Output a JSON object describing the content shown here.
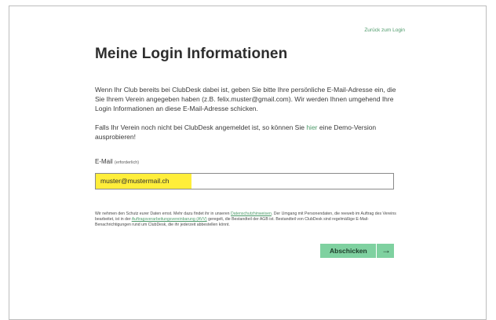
{
  "nav": {
    "back_to_login": "Zurück zum Login"
  },
  "page": {
    "title": "Meine Login Informationen"
  },
  "intro": {
    "paragraph1": "Wenn Ihr Club bereits bei ClubDesk dabei ist, geben Sie bitte Ihre persönliche E-Mail-Adresse ein, die Sie Ihrem Verein angegeben haben (z.B. felix.muster@gmail.com). Wir werden Ihnen umgehend Ihre Login Informationen an diese E-Mail-Adresse schicken.",
    "paragraph2_before": "Falls Ihr Verein noch nicht bei ClubDesk angemeldet ist, so können Sie ",
    "paragraph2_link": "hier",
    "paragraph2_after": " eine Demo-Version ausprobieren!"
  },
  "form": {
    "email_label": "E-Mail",
    "email_required": "(erforderlich)",
    "email_value": "muster@mustermail.ch",
    "highlight_color": "#ffee3a"
  },
  "privacy": {
    "text1": "Wir nehmen den Schutz eurer Daten ernst. Mehr dazu findet ihr in unseren ",
    "link1": "Datenschutzhinweisen",
    "text2": ". Der Umgang mit Personendaten, die reeweb im Auftrag des Vereins bearbeitet, ist in der ",
    "link2": "Auftragsverarbeitungsvereinbarung (AVV)",
    "text3": " geregelt, die Bestandteil der AGB ist. Bestandteil von ClubDesk sind regelmäßige E-Mail-Benachrichtigungen rund um ClubDesk, die ihr jederzeit abbestellen könnt."
  },
  "submit": {
    "label": "Abschicken",
    "icon": "arrow-right-icon",
    "color": "#7fd1a0"
  }
}
